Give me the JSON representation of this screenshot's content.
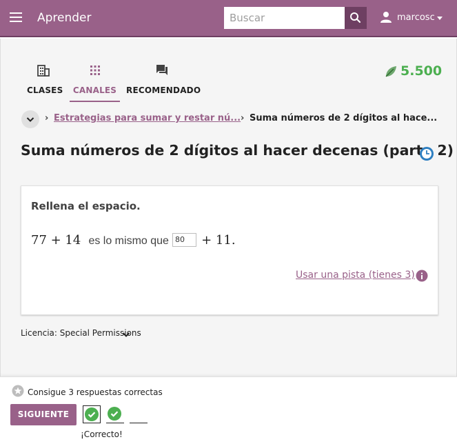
{
  "appbar": {
    "title": "Aprender",
    "search_placeholder": "Buscar",
    "username": "marcosc",
    "background_color": "#996189"
  },
  "tabs": [
    {
      "label": "CLASES",
      "icon": "classes-icon",
      "active": false
    },
    {
      "label": "CANALES",
      "icon": "channels-grid-icon",
      "active": true
    },
    {
      "label": "RECOMENDADO",
      "icon": "recommended-chat-icon",
      "active": false
    }
  ],
  "points": {
    "value": "5.500",
    "icon": "points-leaf-icon",
    "color": "#4caf50"
  },
  "breadcrumb": {
    "separator": "›",
    "parent": "Estrategias para sumar y restar nú...",
    "current": "Suma números de 2 dígitos al hace..."
  },
  "lesson": {
    "title": "Suma números de 2 dígitos al hacer decenas (parte 2)",
    "status_icon": "in-progress-clock-icon"
  },
  "exercise": {
    "prompt": "Rellena el espacio.",
    "math_left": "77 + 14",
    "connector": "es lo mismo que",
    "answer_value": "80",
    "math_right": "+ 11.",
    "hint_label": "Usar una pista (tienes 3)"
  },
  "license": {
    "label": "Licencia: Special Permissions"
  },
  "progress": {
    "goal_text": "Consigue 3 respuestas correctas",
    "next_label": "SIGUIENTE",
    "attempts": [
      "correct",
      "correct",
      "empty"
    ],
    "feedback": "¡Correcto!",
    "correct_color": "#4caf50"
  }
}
